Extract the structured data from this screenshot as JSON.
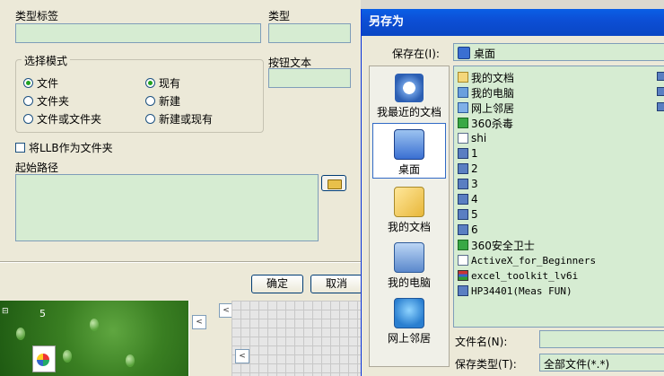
{
  "left_dialog": {
    "type_label_caption": "类型标签",
    "type_label_value": "",
    "type_caption": "类型",
    "type_value": "",
    "select_mode": {
      "legend": "选择模式",
      "options": [
        {
          "label": "文件",
          "selected": true
        },
        {
          "label": "文件夹",
          "selected": false
        },
        {
          "label": "文件或文件夹",
          "selected": false
        },
        {
          "label": "现有",
          "selected": true
        },
        {
          "label": "新建",
          "selected": false
        },
        {
          "label": "新建或现有",
          "selected": false
        }
      ]
    },
    "button_text_caption": "按钮文本",
    "button_text_value": "",
    "llb_checkbox_label": "将LLB作为文件夹",
    "llb_checked": false,
    "start_path_caption": "起始路径",
    "start_path_value": "",
    "ok_button": "确定",
    "cancel_button": "取消"
  },
  "background": {
    "page_number": "5",
    "scroll_left_arrow": "<"
  },
  "save_as_dialog": {
    "title": "另存为",
    "save_in_label": "保存在(I):",
    "save_in_value": "桌面",
    "places": [
      {
        "label": "我最近的文档",
        "icon": "recent-docs-icon",
        "selected": false
      },
      {
        "label": "桌面",
        "icon": "desktop-icon",
        "selected": true
      },
      {
        "label": "我的文档",
        "icon": "my-docs-icon",
        "selected": false
      },
      {
        "label": "我的电脑",
        "icon": "my-computer-icon",
        "selected": false
      },
      {
        "label": "网上邻居",
        "icon": "network-icon",
        "selected": false
      }
    ],
    "files": [
      {
        "name": "我的文档",
        "kind": "folder"
      },
      {
        "name": "我的电脑",
        "kind": "pc"
      },
      {
        "name": "网上邻居",
        "kind": "net"
      },
      {
        "name": "360杀毒",
        "kind": "app"
      },
      {
        "name": "shi",
        "kind": "gen"
      },
      {
        "name": "1",
        "kind": "doc"
      },
      {
        "name": "2",
        "kind": "doc"
      },
      {
        "name": "3",
        "kind": "doc"
      },
      {
        "name": "4",
        "kind": "doc"
      },
      {
        "name": "5",
        "kind": "doc"
      },
      {
        "name": "6",
        "kind": "doc"
      },
      {
        "name": "360安全卫士",
        "kind": "app"
      },
      {
        "name": "ActiveX_for_Beginners",
        "kind": "gen"
      },
      {
        "name": "excel_toolkit_lv6i",
        "kind": "rar"
      },
      {
        "name": "HP34401(Meas FUN)",
        "kind": "doc"
      }
    ],
    "filename_label": "文件名(N):",
    "filename_value": "",
    "filetype_label": "保存类型(T):",
    "filetype_value": "全部文件(*.*)"
  },
  "colors": {
    "title_blue": "#0a5fe6",
    "field_green": "#d6ecd2",
    "dialog_bg": "#ece9d8"
  }
}
